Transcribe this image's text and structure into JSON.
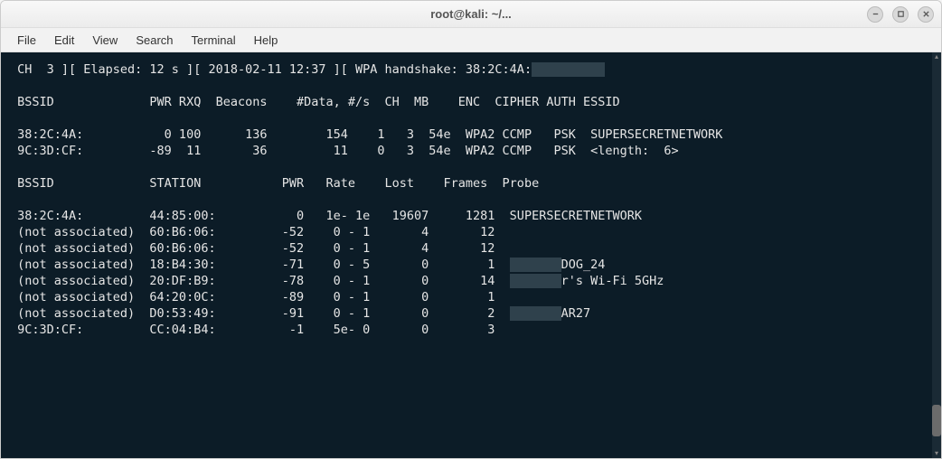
{
  "window": {
    "title": "root@kali: ~/..."
  },
  "menu": {
    "file": "File",
    "edit": "Edit",
    "view": "View",
    "search": "Search",
    "terminal": "Terminal",
    "help": "Help"
  },
  "status_line": {
    "ch_label": "CH",
    "ch": "3",
    "elapsed_label": "Elapsed:",
    "elapsed": "12 s",
    "datetime": "2018-02-11 12:37",
    "handshake_label": "WPA handshake:",
    "handshake_mac": "38:2C:4A:"
  },
  "ap_header": {
    "bssid": "BSSID",
    "pwr": "PWR",
    "rxq": "RXQ",
    "beacons": "Beacons",
    "data": "#Data,",
    "persec": "#/s",
    "ch": "CH",
    "mb": "MB",
    "enc": "ENC",
    "cipher": "CIPHER",
    "auth": "AUTH",
    "essid": "ESSID"
  },
  "ap_rows": [
    {
      "bssid": "38:2C:4A:",
      "pwr": "0",
      "rxq": "100",
      "beacons": "136",
      "data": "154",
      "persec": "1",
      "ch": "3",
      "mb": "54e",
      "enc": "WPA2",
      "cipher": "CCMP",
      "auth": "PSK",
      "essid": "SUPERSECRETNETWORK"
    },
    {
      "bssid": "9C:3D:CF:",
      "pwr": "-89",
      "rxq": "11",
      "beacons": "36",
      "data": "11",
      "persec": "0",
      "ch": "3",
      "mb": "54e",
      "enc": "WPA2",
      "cipher": "CCMP",
      "auth": "PSK",
      "essid": "<length:  6>"
    }
  ],
  "sta_header": {
    "bssid": "BSSID",
    "station": "STATION",
    "pwr": "PWR",
    "rate": "Rate",
    "lost": "Lost",
    "frames": "Frames",
    "probe": "Probe"
  },
  "sta_rows": [
    {
      "bssid": "38:2C:4A:",
      "station": "44:85:00:",
      "pwr": "0",
      "rate": "1e- 1e",
      "lost": "19607",
      "frames": "1281",
      "probe": "SUPERSECRETNETWORK"
    },
    {
      "bssid": "(not associated)",
      "station": "60:B6:06:",
      "pwr": "-52",
      "rate": "0 - 1",
      "lost": "4",
      "frames": "12",
      "probe": ""
    },
    {
      "bssid": "(not associated)",
      "station": "60:B6:06:",
      "pwr": "-52",
      "rate": "0 - 1",
      "lost": "4",
      "frames": "12",
      "probe": ""
    },
    {
      "bssid": "(not associated)",
      "station": "18:B4:30:",
      "pwr": "-71",
      "rate": "0 - 5",
      "lost": "0",
      "frames": "1",
      "probe": "DOG_24"
    },
    {
      "bssid": "(not associated)",
      "station": "20:DF:B9:",
      "pwr": "-78",
      "rate": "0 - 1",
      "lost": "0",
      "frames": "14",
      "probe": "r's Wi-Fi 5GHz"
    },
    {
      "bssid": "(not associated)",
      "station": "64:20:0C:",
      "pwr": "-89",
      "rate": "0 - 1",
      "lost": "0",
      "frames": "1",
      "probe": ""
    },
    {
      "bssid": "(not associated)",
      "station": "D0:53:49:",
      "pwr": "-91",
      "rate": "0 - 1",
      "lost": "0",
      "frames": "2",
      "probe": "AR27"
    },
    {
      "bssid": "9C:3D:CF:",
      "station": "CC:04:B4:",
      "pwr": "-1",
      "rate": "5e- 0",
      "lost": "0",
      "frames": "3",
      "probe": ""
    }
  ],
  "redacted_probe_indices": [
    3,
    4,
    6
  ]
}
